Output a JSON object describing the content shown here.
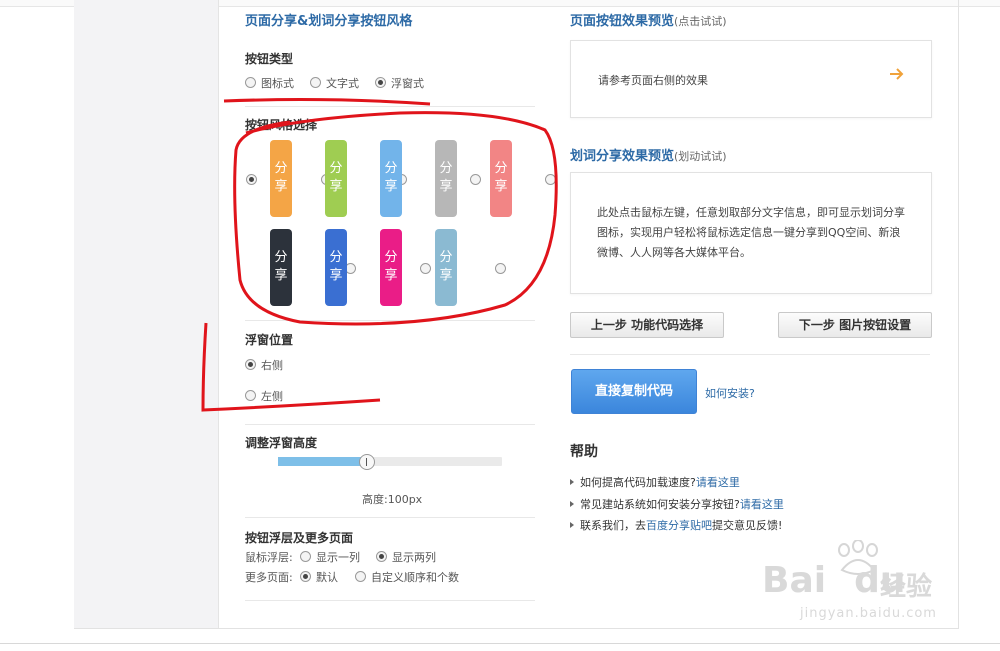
{
  "left": {
    "title": "页面分享&划词分享按钮风格",
    "button_type": {
      "heading": "按钮类型",
      "options": [
        {
          "label": "图标式",
          "checked": false
        },
        {
          "label": "文字式",
          "checked": false
        },
        {
          "label": "浮窗式",
          "checked": true
        }
      ]
    },
    "style_select": {
      "heading": "按钮风格选择",
      "chip_text": [
        "分",
        "享"
      ],
      "row1": [
        {
          "color": "#f4a546",
          "checked": true
        },
        {
          "color": "#9fcd52",
          "checked": false
        },
        {
          "color": "#72b4ea",
          "checked": false
        },
        {
          "color": "#b7b7b7",
          "checked": false
        },
        {
          "color": "#f28585",
          "checked": false
        }
      ],
      "row2": [
        {
          "color": "#2c323b",
          "checked": false
        },
        {
          "color": "#3a6fd2",
          "checked": false
        },
        {
          "color": "#ea1d87",
          "checked": false
        },
        {
          "color": "#8bbad2",
          "checked": false
        }
      ]
    },
    "float_position": {
      "heading": "浮窗位置",
      "right": "右侧",
      "left": "左侧",
      "selected": "right"
    },
    "height": {
      "heading": "调整浮窗高度",
      "label": "高度:100px",
      "slider_fraction": 0.38
    },
    "more": {
      "heading": "按钮浮层及更多页面",
      "mouse_label": "鼠标浮层:",
      "mouse_opt1": "显示一列",
      "mouse_opt2": "显示两列",
      "pages_label": "更多页面:",
      "pages_opt1": "默认",
      "pages_opt2": "自定义顺序和个数"
    }
  },
  "right": {
    "page_preview_title": "页面按钮效果预览",
    "page_preview_hint": "(点击试试)",
    "page_preview_text": "请参考页面右侧的效果",
    "arrow_icon": "arrow-right-icon",
    "arrow_color": "#f0a23a",
    "word_preview_title": "划词分享效果预览",
    "word_preview_hint": "(划动试试)",
    "word_preview_text": "此处点击鼠标左键，任意划取部分文字信息，即可显示划词分享图标，实现用户轻松将鼠标选定信息一键分享到QQ空间、新浪微博、人人网等各大媒体平台。",
    "prev_button": "上一步 功能代码选择",
    "next_button": "下一步 图片按钮设置",
    "copy_button": "直接复制代码",
    "install_link": "如何安装?",
    "help_title": "帮助",
    "help_items": [
      {
        "text": "如何提高代码加载速度?",
        "link": "请看这里",
        "after": ""
      },
      {
        "text": "常见建站系统如何安装分享按钮?",
        "link": "请看这里",
        "after": ""
      },
      {
        "text": "联系我们，去",
        "link": "百度分享贴吧",
        "after": "提交意见反馈!"
      }
    ]
  },
  "watermark": {
    "brand": "Bai",
    "brand2": "du",
    "cn": "经验",
    "url": "jingyan.baidu.com"
  },
  "colors": {
    "accent": "#2d6aa6",
    "annotation": "#e0141b"
  }
}
